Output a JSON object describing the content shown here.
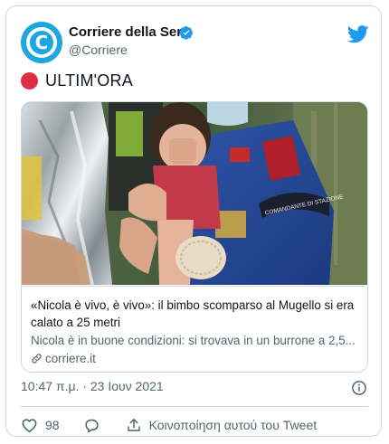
{
  "account": {
    "name": "Corriere della Sera",
    "handle": "@Corriere",
    "avatar_letter": "C"
  },
  "tweet": {
    "text": "ULTIM'ORA",
    "emoji": "red-circle"
  },
  "link_card": {
    "title": "«Nicola è vivo, è vivo»: il bimbo scomparso al Mugello si era calato a 25 metri",
    "description": "Nicola è in buone condizioni: si trovava in un burrone a 2,5...",
    "domain": "corriere.it",
    "image_badge_text": "COMANDANTE DI STAZIONE"
  },
  "meta": {
    "timestamp": "10:47 π.μ. · 23 Ιουν 2021"
  },
  "actions": {
    "like_count": "98",
    "share_label": "Κοινοποίηση αυτού του Tweet"
  },
  "colors": {
    "brand_blue": "#1d9bf0",
    "text_secondary": "#536471",
    "border": "#cfd9de",
    "red_dot": "#dd2e44"
  },
  "icons": [
    "verified-badge-icon",
    "twitter-bird-icon",
    "info-icon",
    "heart-icon",
    "reply-icon",
    "share-icon",
    "link-icon"
  ]
}
